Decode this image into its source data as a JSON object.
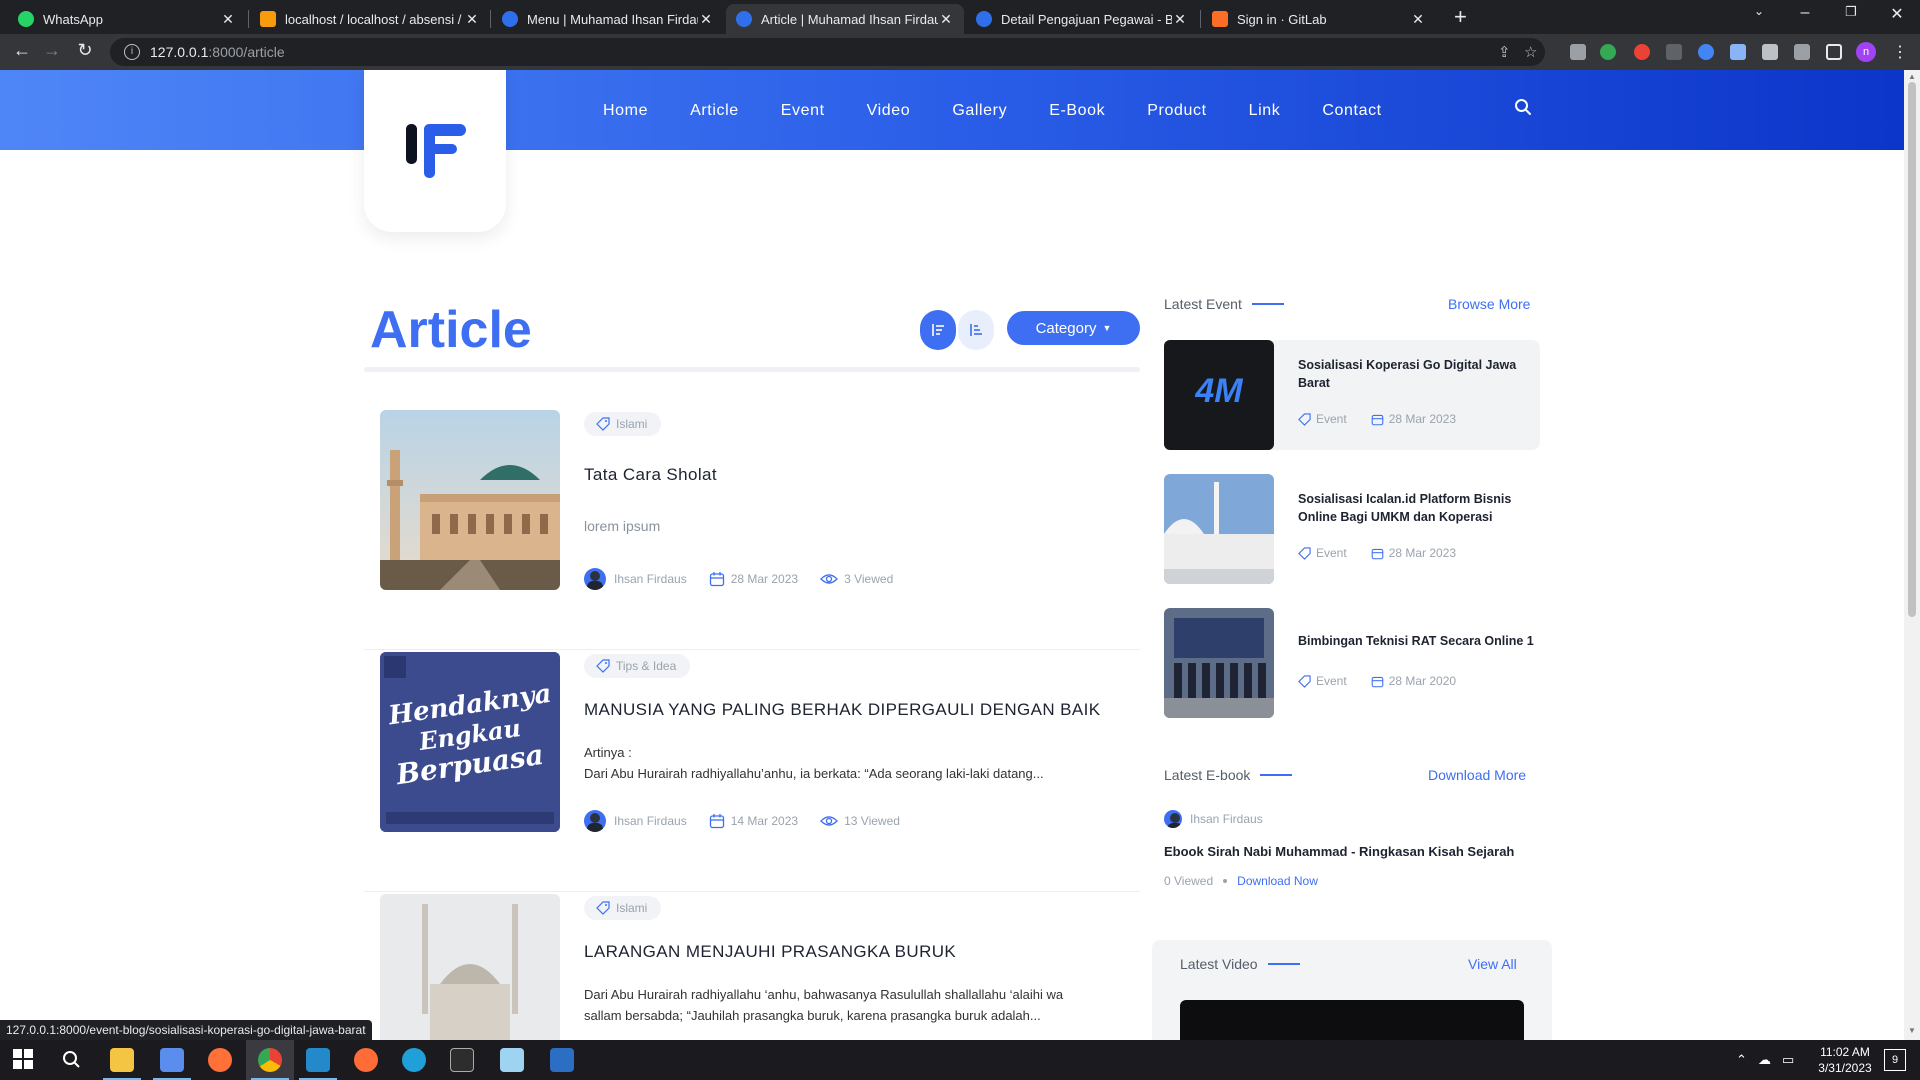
{
  "browser": {
    "tabs": [
      {
        "title": "WhatsApp",
        "color": "#25d366"
      },
      {
        "title": "localhost / localhost / absensi / p",
        "color": "#f89c0e"
      },
      {
        "title": "Menu | Muhamad Ihsan Firdaus",
        "color": "#2f6fec"
      },
      {
        "title": "Article | Muhamad Ihsan Firdaus",
        "color": "#2f6fec"
      },
      {
        "title": "Detail Pengajuan Pegawai - Base",
        "color": "#2f6fec"
      },
      {
        "title": "Sign in · GitLab",
        "color": "#fc6d26"
      }
    ],
    "active_tab": 3,
    "url_host": "127.0.0.1",
    "url_path": ":8000/article",
    "status_url": "127.0.0.1:8000/event-blog/sosialisasi-koperasi-go-digital-jawa-barat"
  },
  "site": {
    "nav": [
      "Home",
      "Article",
      "Event",
      "Video",
      "Gallery",
      "E-Book",
      "Product",
      "Link",
      "Contact"
    ],
    "brand_color": "#3e6ff2"
  },
  "page": {
    "title": "Article",
    "category_label": "Category"
  },
  "articles": [
    {
      "tag": "Islami",
      "title": "Tata Cara Sholat",
      "excerpt_lines": [
        "lorem ipsum"
      ],
      "author": "Ihsan Firdaus",
      "date": "28 Mar 2023",
      "views": "3 Viewed"
    },
    {
      "tag": "Tips & Idea",
      "title": "MANUSIA YANG PALING BERHAK DIPERGAULI DENGAN BAIK",
      "excerpt_lines": [
        "Artinya :",
        "Dari Abu Hurairah radhiyallahu’anhu, ia berkata: “Ada seorang laki-laki datang..."
      ],
      "author": "Ihsan Firdaus",
      "date": "14 Mar 2023",
      "views": "13 Viewed",
      "image_text": [
        "Hendaknya",
        "Engkau",
        "Berpuasa"
      ]
    },
    {
      "tag": "Islami",
      "title": "LARANGAN MENJAUHI PRASANGKA BURUK",
      "excerpt_lines": [
        "Dari Abu Hurairah radhiyallahu ‘anhu, bahwasanya Rasulullah shallallahu ‘alaihi wa",
        "sallam  bersabda; “Jauhilah prasangka buruk, karena prasangka buruk adalah..."
      ]
    }
  ],
  "sidebar": {
    "latest_event": {
      "heading": "Latest Event",
      "more": "Browse More",
      "items": [
        {
          "title": "Sosialisasi Koperasi Go Digital Jawa Barat",
          "type": "Event",
          "date": "28 Mar 2023",
          "thumb_text": "4M"
        },
        {
          "title": "Sosialisasi Icalan.id Platform Bisnis Online Bagi UMKM dan Koperasi",
          "type": "Event",
          "date": "28 Mar 2023"
        },
        {
          "title": "Bimbingan Teknisi RAT Secara Online 1",
          "type": "Event",
          "date": "28 Mar 2020"
        }
      ]
    },
    "latest_ebook": {
      "heading": "Latest E-book",
      "more": "Download More",
      "author": "Ihsan Firdaus",
      "title": "Ebook Sirah Nabi Muhammad - Ringkasan Kisah Sejarah",
      "views": "0 Viewed",
      "download": "Download Now"
    },
    "latest_video": {
      "heading": "Latest Video",
      "more": "View All"
    }
  },
  "taskbar": {
    "time": "11:02 AM",
    "date": "3/31/2023",
    "notifications": "9"
  }
}
